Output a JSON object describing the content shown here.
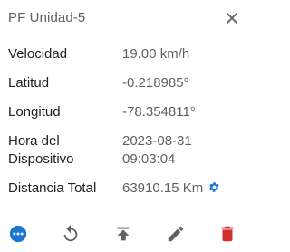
{
  "header": {
    "title": "PF Unidad-5",
    "close_icon": "close-icon"
  },
  "attributes": [
    {
      "label": "Velocidad",
      "value": "19.00 km/h"
    },
    {
      "label": "Latitud",
      "value": "-0.218985°"
    },
    {
      "label": "Longitud",
      "value": "-78.354811°"
    },
    {
      "label": "Hora del Dispositivo",
      "label_line1": "Hora del",
      "label_line2": "Dispositivo",
      "value_line1": "2023-08-31",
      "value_line2": "09:03:04"
    },
    {
      "label": "Distancia Total",
      "value": "63910.15 Km",
      "icon": "gear-icon"
    }
  ],
  "toolbar": {
    "icons": [
      "more-icon",
      "replay-icon",
      "upload-icon",
      "edit-icon",
      "delete-icon"
    ]
  },
  "colors": {
    "accent": "#1976d2",
    "delete": "#d32f2f",
    "icon": "#616161"
  }
}
